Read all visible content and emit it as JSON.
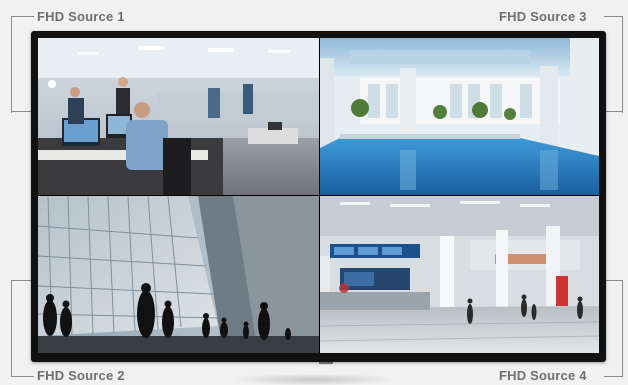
{
  "labels": {
    "top_left": "FHD Source 1",
    "top_right": "FHD Source 3",
    "bottom_left": "FHD Source 2",
    "bottom_right": "FHD Source 4"
  },
  "colors": {
    "label_text": "#6f6f6f",
    "bracket_line": "#8a8a8a",
    "monitor_bezel": "#111111",
    "background": "#f1f1f1"
  },
  "feeds": [
    {
      "scene": "office"
    },
    {
      "scene": "building-exterior"
    },
    {
      "scene": "indoor-pool"
    },
    {
      "scene": "transit-terminal"
    }
  ]
}
